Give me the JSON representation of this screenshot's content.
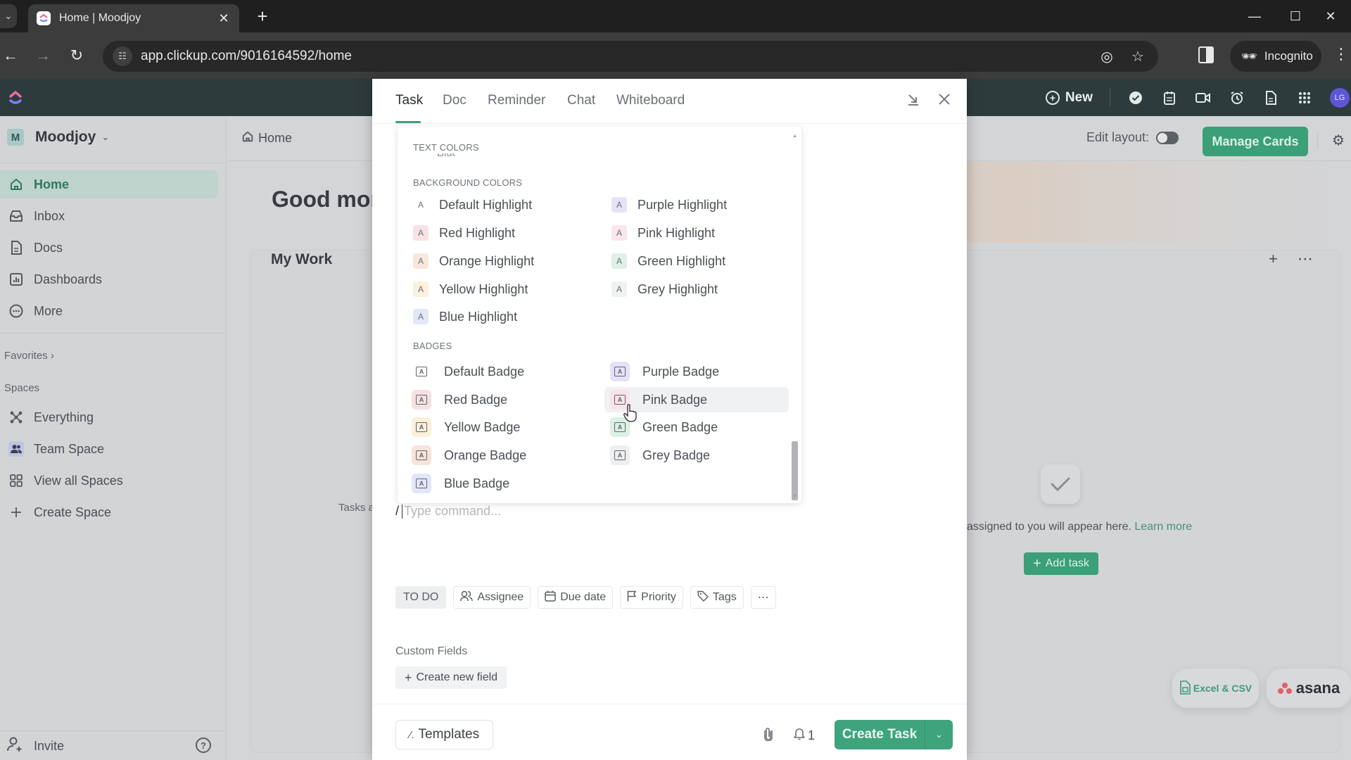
{
  "browser": {
    "tab_title": "Home | Moodjoy",
    "url": "app.clickup.com/9016164592/home",
    "incognito_label": "Incognito"
  },
  "appbar": {
    "new_label": "New",
    "avatar_initials": "LG"
  },
  "sidebar": {
    "workspace_initial": "M",
    "workspace_name": "Moodjoy",
    "items": [
      {
        "label": "Home",
        "icon": "home-icon",
        "active": true
      },
      {
        "label": "Inbox",
        "icon": "inbox-icon"
      },
      {
        "label": "Docs",
        "icon": "docs-icon"
      },
      {
        "label": "Dashboards",
        "icon": "dashboards-icon"
      },
      {
        "label": "More",
        "icon": "more-icon"
      }
    ],
    "favorites_label": "Favorites",
    "spaces_label": "Spaces",
    "spaces": [
      {
        "label": "Everything",
        "icon": "everything-icon"
      },
      {
        "label": "Team Space",
        "icon": "team-space-icon"
      },
      {
        "label": "View all Spaces",
        "icon": "grid-icon"
      },
      {
        "label": "Create Space",
        "icon": "plus-icon"
      }
    ],
    "invite_label": "Invite"
  },
  "main": {
    "breadcrumb": "Home",
    "edit_layout_label": "Edit layout:",
    "edit_layout_on": false,
    "manage_cards_label": "Manage Cards",
    "greeting": "Good mor",
    "card_title": "My Work",
    "tasks_partial": "Tasks a",
    "empty_text": "assigned to you will appear here.",
    "learn_more": "Learn more",
    "add_task_label": "Add task",
    "import_excel_label": "Excel & CSV",
    "import_asana_label": "asana"
  },
  "modal": {
    "tabs": [
      {
        "label": "Task",
        "active": true
      },
      {
        "label": "Doc"
      },
      {
        "label": "Reminder"
      },
      {
        "label": "Chat"
      },
      {
        "label": "Whiteboard"
      }
    ],
    "popover": {
      "text_colors_label": "TEXT COLORS",
      "text_colors_cut_item": "Blue",
      "background_colors_label": "BACKGROUND COLORS",
      "highlights": [
        {
          "label": "Default Highlight",
          "color": "#ffffff"
        },
        {
          "label": "Purple Highlight",
          "color": "#e6e3f7"
        },
        {
          "label": "Red Highlight",
          "color": "#f8e3e4"
        },
        {
          "label": "Pink Highlight",
          "color": "#fbe6ee"
        },
        {
          "label": "Orange Highlight",
          "color": "#f9e7de"
        },
        {
          "label": "Green Highlight",
          "color": "#dff1e7"
        },
        {
          "label": "Yellow Highlight",
          "color": "#fbf1dc"
        },
        {
          "label": "Grey Highlight",
          "color": "#f0f1f3"
        },
        {
          "label": "Blue Highlight",
          "color": "#e3e8f8"
        }
      ],
      "badges_label": "BADGES",
      "badges": [
        {
          "label": "Default Badge",
          "color": "#ffffff"
        },
        {
          "label": "Purple Badge",
          "color": "#e4e2f8"
        },
        {
          "label": "Red Badge",
          "color": "#f7e0e2"
        },
        {
          "label": "Pink Badge",
          "color": "#f9e3ea",
          "hovered": true
        },
        {
          "label": "Yellow Badge",
          "color": "#fbf0da"
        },
        {
          "label": "Green Badge",
          "color": "#dcf0e4"
        },
        {
          "label": "Orange Badge",
          "color": "#f8e4da"
        },
        {
          "label": "Grey Badge",
          "color": "#eeeff1"
        },
        {
          "label": "Blue Badge",
          "color": "#e2e6f8"
        }
      ]
    },
    "command_placeholder": "Type command...",
    "status_label": "TO DO",
    "properties": [
      {
        "label": "Assignee",
        "icon": "assignee-icon"
      },
      {
        "label": "Due date",
        "icon": "calendar-icon"
      },
      {
        "label": "Priority",
        "icon": "flag-icon"
      },
      {
        "label": "Tags",
        "icon": "tag-icon"
      }
    ],
    "custom_fields_label": "Custom Fields",
    "create_field_label": "Create new field",
    "templates_label": "Templates",
    "notification_count": "1",
    "create_task_label": "Create Task"
  },
  "colors": {
    "accent": "#3ea47d",
    "appbar": "#2e3b3c",
    "avatar": "#5f55d6"
  }
}
